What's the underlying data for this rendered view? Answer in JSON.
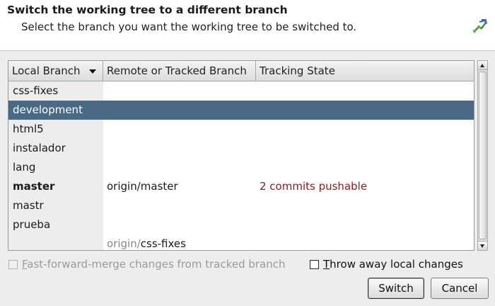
{
  "header": {
    "title": "Switch the working tree to a different branch",
    "subtitle": "Select the branch you want the working tree to be switched to.",
    "icon": "branch-switch-wizard-icon"
  },
  "table": {
    "columns": [
      "Local Branch",
      "Remote or Tracked Branch",
      "Tracking State"
    ],
    "sort_column": "Local Branch",
    "sort_direction": "descending-indicator",
    "rows": [
      {
        "local": "css-fixes",
        "remote": "",
        "state": ""
      },
      {
        "local": "development",
        "remote": "",
        "state": "",
        "selected": true
      },
      {
        "local": "html5",
        "remote": "",
        "state": ""
      },
      {
        "local": "instalador",
        "remote": "",
        "state": ""
      },
      {
        "local": "lang",
        "remote": "",
        "state": ""
      },
      {
        "local": "master",
        "remote": "origin/master",
        "state": "2 commits pushable",
        "current": true
      },
      {
        "local": "mastr",
        "remote": "",
        "state": ""
      },
      {
        "local": "prueba",
        "remote": "",
        "state": ""
      },
      {
        "local": "",
        "remote_prefix": "origin/",
        "remote_name": "css-fixes",
        "state": ""
      }
    ]
  },
  "options": {
    "fast_forward": {
      "label": "Fast-forward-merge changes from tracked branch",
      "checked": false,
      "enabled": false
    },
    "throw_away": {
      "label": "Throw away local changes",
      "checked": false,
      "enabled": true
    }
  },
  "buttons": {
    "switch": "Switch",
    "cancel": "Cancel"
  },
  "colors": {
    "selection": "#4a6984",
    "tracking_state": "#8b1a1a"
  }
}
